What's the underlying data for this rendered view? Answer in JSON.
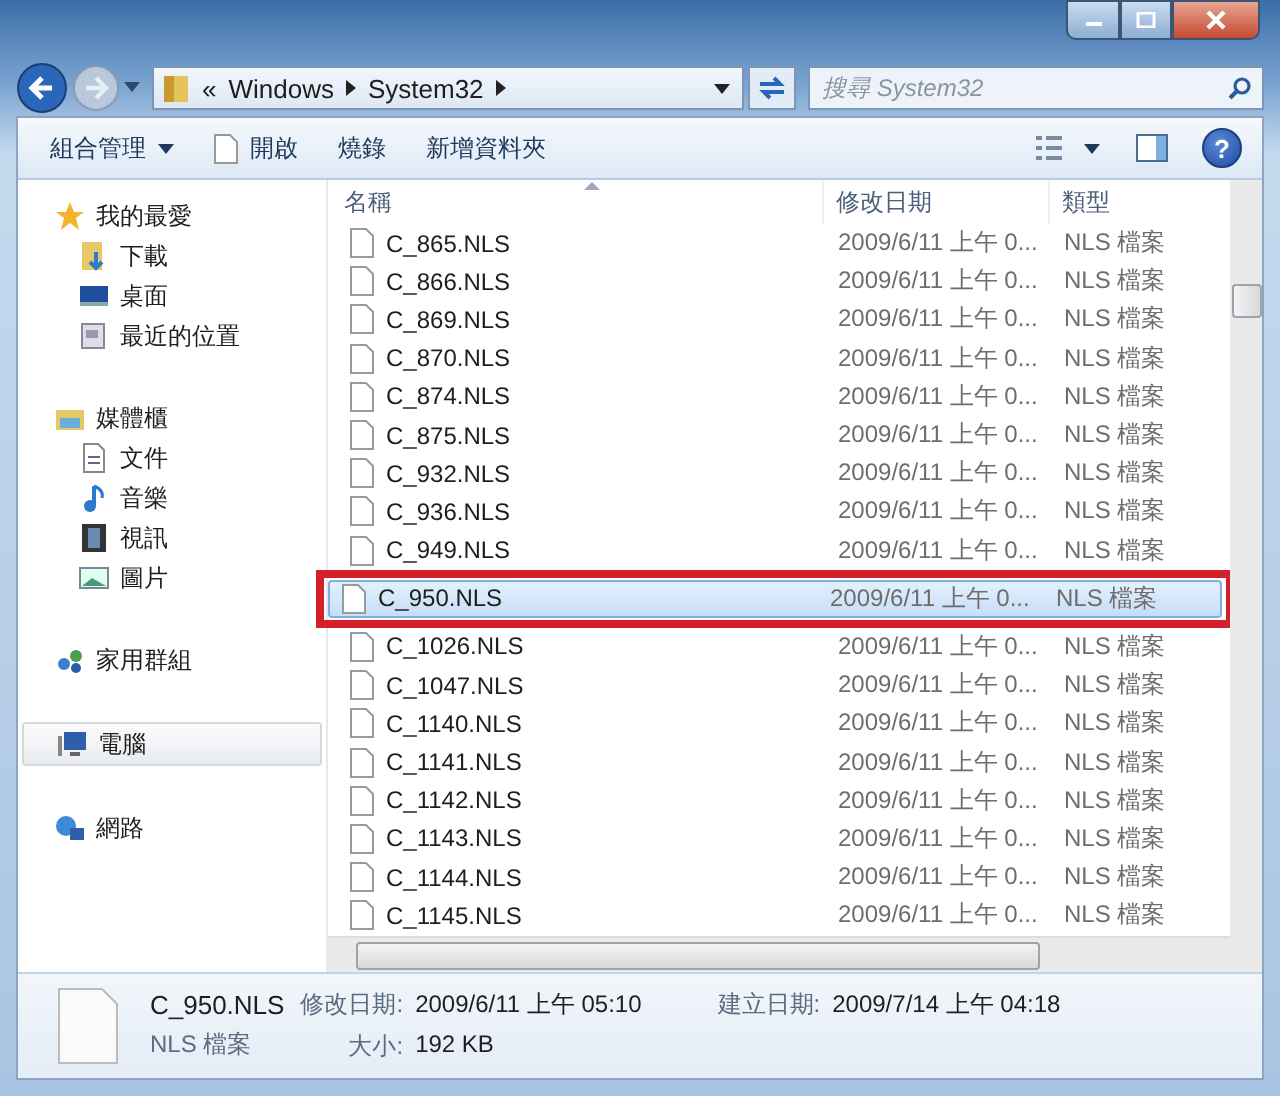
{
  "window": {
    "caption_buttons": [
      {
        "kind": "minimize"
      },
      {
        "kind": "maximize"
      },
      {
        "kind": "close"
      }
    ]
  },
  "address_bar": {
    "path": [
      "«",
      "Windows",
      "System32"
    ]
  },
  "search": {
    "placeholder": "搜尋 System32"
  },
  "toolbar": {
    "items": [
      {
        "label": "組合管理",
        "kind": "menu"
      },
      {
        "label": "開啟",
        "kind": "open"
      },
      {
        "label": "燒錄",
        "kind": "plain"
      },
      {
        "label": "新增資料夾",
        "kind": "plain"
      }
    ]
  },
  "sidebar": {
    "groups": [
      {
        "label": "我的最愛",
        "kind": "star",
        "selected": false,
        "children": [
          {
            "label": "下載",
            "kind": "download",
            "selected": false
          },
          {
            "label": "桌面",
            "kind": "desktop",
            "selected": false
          },
          {
            "label": "最近的位置",
            "kind": "recent",
            "selected": false
          }
        ]
      },
      {
        "label": "媒體櫃",
        "kind": "library",
        "selected": false,
        "children": [
          {
            "label": "文件",
            "kind": "document",
            "selected": false
          },
          {
            "label": "音樂",
            "kind": "music",
            "selected": false
          },
          {
            "label": "視訊",
            "kind": "video",
            "selected": false
          },
          {
            "label": "圖片",
            "kind": "picture",
            "selected": false
          }
        ]
      },
      {
        "label": "家用群組",
        "kind": "homegroup",
        "selected": false
      },
      {
        "label": "電腦",
        "kind": "computer",
        "selected": true
      },
      {
        "label": "網路",
        "kind": "network",
        "selected": false
      }
    ]
  },
  "help_button": {
    "label": "?"
  },
  "table": {
    "columns": [
      "名稱",
      "修改日期",
      "類型"
    ],
    "rows": [
      {
        "name": "C_865.NLS",
        "modified": "2009/6/11 上午 0...",
        "type": "NLS 檔案",
        "selected": false,
        "highlighted": false
      },
      {
        "name": "C_866.NLS",
        "modified": "2009/6/11 上午 0...",
        "type": "NLS 檔案",
        "selected": false,
        "highlighted": false
      },
      {
        "name": "C_869.NLS",
        "modified": "2009/6/11 上午 0...",
        "type": "NLS 檔案",
        "selected": false,
        "highlighted": false
      },
      {
        "name": "C_870.NLS",
        "modified": "2009/6/11 上午 0...",
        "type": "NLS 檔案",
        "selected": false,
        "highlighted": false
      },
      {
        "name": "C_874.NLS",
        "modified": "2009/6/11 上午 0...",
        "type": "NLS 檔案",
        "selected": false,
        "highlighted": false
      },
      {
        "name": "C_875.NLS",
        "modified": "2009/6/11 上午 0...",
        "type": "NLS 檔案",
        "selected": false,
        "highlighted": false
      },
      {
        "name": "C_932.NLS",
        "modified": "2009/6/11 上午 0...",
        "type": "NLS 檔案",
        "selected": false,
        "highlighted": false
      },
      {
        "name": "C_936.NLS",
        "modified": "2009/6/11 上午 0...",
        "type": "NLS 檔案",
        "selected": false,
        "highlighted": false
      },
      {
        "name": "C_949.NLS",
        "modified": "2009/6/11 上午 0...",
        "type": "NLS 檔案",
        "selected": false,
        "highlighted": false
      },
      {
        "name": "C_950.NLS",
        "modified": "2009/6/11 上午 0...",
        "type": "NLS 檔案",
        "selected": true,
        "highlighted": true
      },
      {
        "name": "C_1026.NLS",
        "modified": "2009/6/11 上午 0...",
        "type": "NLS 檔案",
        "selected": false,
        "highlighted": false
      },
      {
        "name": "C_1047.NLS",
        "modified": "2009/6/11 上午 0...",
        "type": "NLS 檔案",
        "selected": false,
        "highlighted": false
      },
      {
        "name": "C_1140.NLS",
        "modified": "2009/6/11 上午 0...",
        "type": "NLS 檔案",
        "selected": false,
        "highlighted": false
      },
      {
        "name": "C_1141.NLS",
        "modified": "2009/6/11 上午 0...",
        "type": "NLS 檔案",
        "selected": false,
        "highlighted": false
      },
      {
        "name": "C_1142.NLS",
        "modified": "2009/6/11 上午 0...",
        "type": "NLS 檔案",
        "selected": false,
        "highlighted": false
      },
      {
        "name": "C_1143.NLS",
        "modified": "2009/6/11 上午 0...",
        "type": "NLS 檔案",
        "selected": false,
        "highlighted": false
      },
      {
        "name": "C_1144.NLS",
        "modified": "2009/6/11 上午 0...",
        "type": "NLS 檔案",
        "selected": false,
        "highlighted": false
      },
      {
        "name": "C_1145.NLS",
        "modified": "2009/6/11 上午 0...",
        "type": "NLS 檔案",
        "selected": false,
        "highlighted": false
      }
    ]
  },
  "details_pane": {
    "name": "C_950.NLS",
    "type": "NLS 檔案",
    "fields": [
      {
        "label": "修改日期:",
        "value": "2009/6/11 上午 05:10"
      },
      {
        "label": "建立日期:",
        "value": "2009/7/14 上午 04:18"
      },
      {
        "label": "大小:",
        "value": "192 KB"
      }
    ]
  }
}
